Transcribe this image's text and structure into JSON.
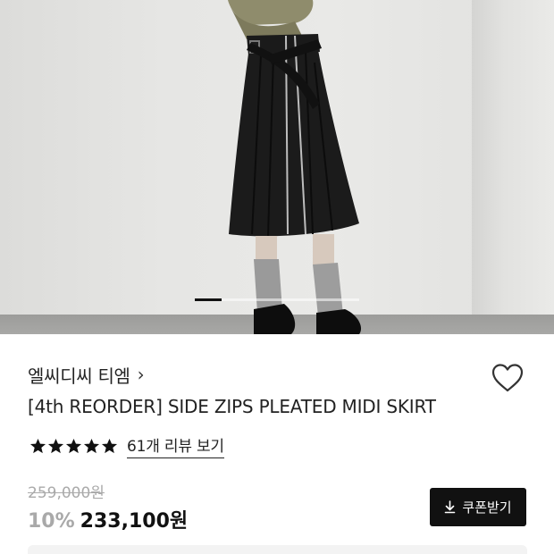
{
  "product": {
    "brand": "엘씨디씨 티엠",
    "brand_chevron": "›",
    "title": "[4th REORDER] SIDE ZIPS PLEATED MIDI SKIRT",
    "rating_stars": 5,
    "review_link": "61개 리뷰 보기",
    "original_price": "259,000원",
    "discount_rate": "10%",
    "sale_price": "233,100원",
    "coupon_label": "쿠폰받기"
  },
  "icons": {
    "wish": "heart-outline-icon",
    "chevron": "chevron-right-icon",
    "star": "star-filled-icon",
    "download": "download-icon"
  },
  "carousel": {
    "active_index": 0,
    "slides_total": 6
  },
  "colors": {
    "accent": "#111111",
    "muted_price": "#aaaaaa",
    "discount": "#a9a9a9"
  }
}
